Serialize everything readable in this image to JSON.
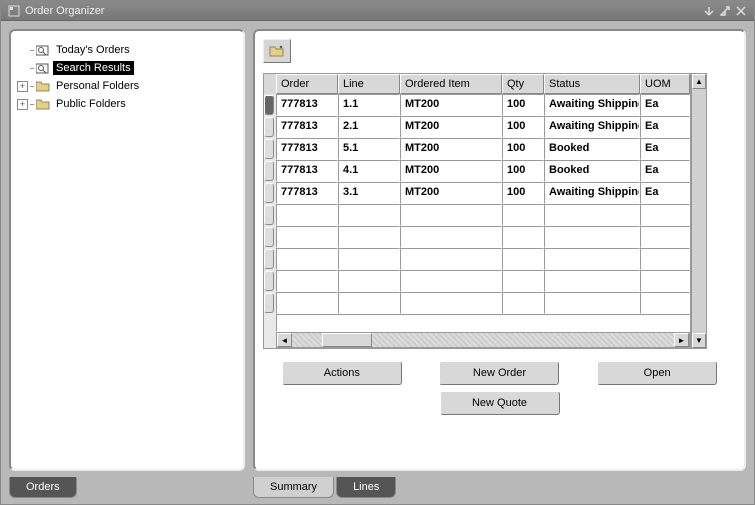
{
  "window": {
    "title": "Order Organizer"
  },
  "tree": {
    "items": [
      {
        "label": "Today's Orders",
        "icon": "search-folder",
        "expandable": false,
        "selected": false
      },
      {
        "label": "Search Results",
        "icon": "search-folder",
        "expandable": false,
        "selected": true
      },
      {
        "label": "Personal Folders",
        "icon": "folder",
        "expandable": true,
        "selected": false
      },
      {
        "label": "Public Folders",
        "icon": "folder",
        "expandable": true,
        "selected": false
      }
    ]
  },
  "grid": {
    "columns": [
      "Order",
      "Line",
      "Ordered Item",
      "Qty",
      "Status",
      "UOM"
    ],
    "rows": [
      {
        "order": "777813",
        "line": "1.1",
        "item": "MT200",
        "qty": "100",
        "status": "Awaiting Shipping",
        "uom": "Ea",
        "selected": true
      },
      {
        "order": "777813",
        "line": "2.1",
        "item": "MT200",
        "qty": "100",
        "status": "Awaiting Shipping",
        "uom": "Ea",
        "selected": false
      },
      {
        "order": "777813",
        "line": "5.1",
        "item": "MT200",
        "qty": "100",
        "status": "Booked",
        "uom": "Ea",
        "selected": false
      },
      {
        "order": "777813",
        "line": "4.1",
        "item": "MT200",
        "qty": "100",
        "status": "Booked",
        "uom": "Ea",
        "selected": false
      },
      {
        "order": "777813",
        "line": "3.1",
        "item": "MT200",
        "qty": "100",
        "status": "Awaiting Shipping",
        "uom": "Ea",
        "selected": false
      }
    ],
    "empty_rows": 5
  },
  "buttons": {
    "actions": "Actions",
    "new_order": "New Order",
    "open": "Open",
    "new_quote": "New Quote"
  },
  "tabs": {
    "left": [
      {
        "label": "Orders",
        "active": true
      }
    ],
    "right": [
      {
        "label": "Summary",
        "active": false
      },
      {
        "label": "Lines",
        "active": true
      }
    ]
  }
}
